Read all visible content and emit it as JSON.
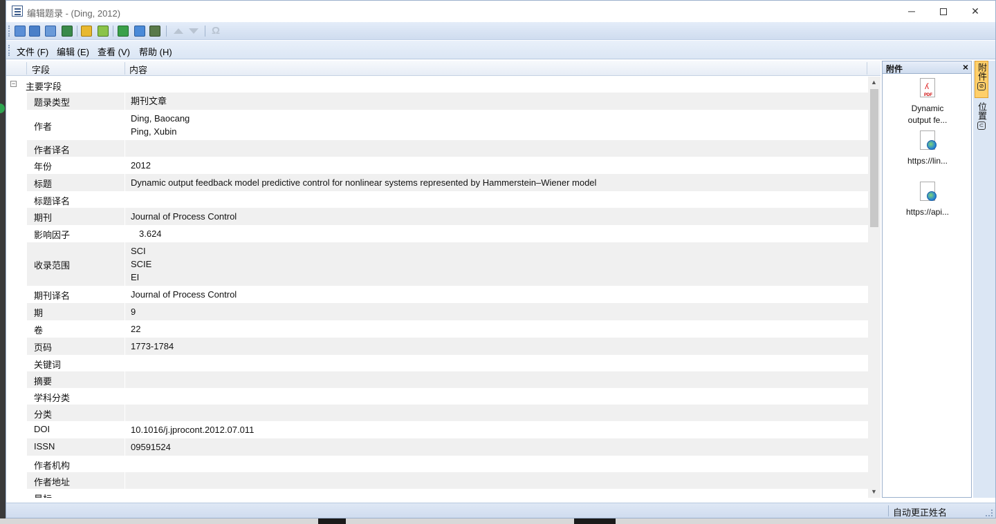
{
  "window": {
    "title": "编辑题录 - (Ding, 2012)"
  },
  "toolbar": {
    "icons": [
      "new-record-icon",
      "save-icon",
      "save-close-icon",
      "export-icon",
      "clean-icon",
      "update-icon",
      "grid-icon",
      "pin-icon",
      "insert-icon",
      "move-up-icon",
      "move-down-icon",
      "omega-symbol-icon"
    ]
  },
  "menu": {
    "file": "文件 (F)",
    "edit": "编辑 (E)",
    "view": "查看 (V)",
    "help": "帮助 (H)"
  },
  "grid": {
    "col_field": "字段",
    "col_content": "内容",
    "group_label": "主要字段",
    "group_toggle": "⊟",
    "rows": [
      {
        "label": "题录类型",
        "value": "期刊文章"
      },
      {
        "label": "作者",
        "value": "Ding, Baocang",
        "value2": "Ping, Xubin"
      },
      {
        "label": "作者译名",
        "value": ""
      },
      {
        "label": "年份",
        "value": "2012"
      },
      {
        "label": "标题",
        "value": "Dynamic output feedback model predictive control for nonlinear systems represented by Hammerstein–Wiener model"
      },
      {
        "label": "标题译名",
        "value": ""
      },
      {
        "label": "期刊",
        "value": "Journal of Process Control"
      },
      {
        "label": "影响因子",
        "value": "3.624"
      },
      {
        "label": "收录范围",
        "value": "SCI",
        "value2": "SCIE",
        "value3": "EI"
      },
      {
        "label": "期刊译名",
        "value": "Journal of Process Control"
      },
      {
        "label": "期",
        "value": "9"
      },
      {
        "label": "卷",
        "value": "22"
      },
      {
        "label": "页码",
        "value": "1773-1784"
      },
      {
        "label": "关键词",
        "value": ""
      },
      {
        "label": "摘要",
        "value": ""
      },
      {
        "label": "学科分类",
        "value": ""
      },
      {
        "label": "分类",
        "value": ""
      },
      {
        "label": "DOI",
        "value": "10.1016/j.jprocont.2012.07.011"
      },
      {
        "label": "ISSN",
        "value": "09591524"
      },
      {
        "label": "作者机构",
        "value": ""
      },
      {
        "label": "作者地址",
        "value": ""
      },
      {
        "label": "星标",
        "value": ""
      }
    ]
  },
  "attachments": {
    "title": "附件",
    "close": "×",
    "items": [
      {
        "line1": "Dynamic",
        "line2": "output fe...",
        "type": "pdf-icon"
      },
      {
        "line1": "https://lin...",
        "type": "web-link-icon"
      },
      {
        "line1": "https://api...",
        "type": "web-link-icon"
      }
    ]
  },
  "side_tabs": {
    "attachments": "附件",
    "location": "位置"
  },
  "status": {
    "text": "自动更正姓名"
  },
  "colors": {
    "accent": "#ffcf6a",
    "chrome": "#dbe6f4",
    "row_alt": "#f0f0f0"
  }
}
